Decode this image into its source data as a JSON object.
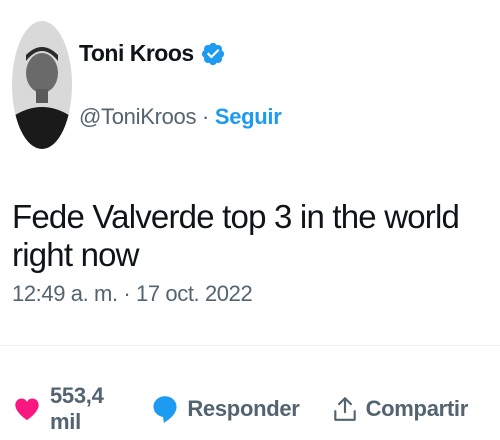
{
  "author": {
    "name": "Toni Kroos",
    "handle": "@ToniKroos",
    "separator": "·",
    "follow_label": "Seguir"
  },
  "tweet": {
    "text": "Fede Valverde top 3 in the world right now",
    "timestamp": "12:49 a. m. · 17 oct. 2022"
  },
  "actions": {
    "likes": "553,4 mil",
    "reply_label": "Responder",
    "share_label": "Compartir"
  },
  "icons": {
    "verified": "verified-badge-icon",
    "like": "heart-icon",
    "reply": "speech-bubble-icon",
    "share": "share-icon"
  },
  "colors": {
    "accent": "#1d9bf0",
    "like": "#f91880",
    "text": "#0f1419",
    "secondary": "#536471"
  }
}
